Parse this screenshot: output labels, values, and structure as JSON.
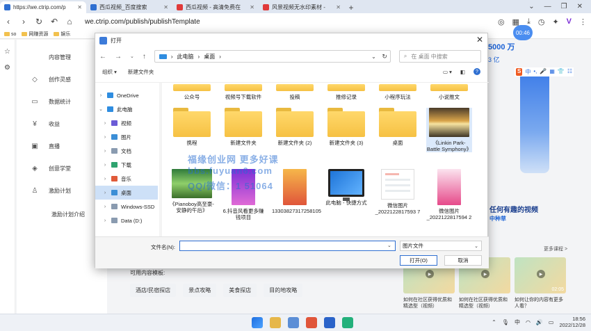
{
  "browser": {
    "tabs": [
      {
        "title": "https://we.ctrip.com/p",
        "color": "#2f6fd1",
        "active": true
      },
      {
        "title": "西瓜视频_百度搜索",
        "color": "#2f6fd1",
        "active": false
      },
      {
        "title": "西瓜视频 - 高清免费在",
        "color": "#e03a3a",
        "active": false
      },
      {
        "title": "风景视频无水印素材 -",
        "color": "#e03a3a",
        "active": false
      }
    ],
    "new_tab": "+",
    "url": "we.ctrip.com/publish/publishTemplate",
    "timer": "00:46",
    "bookmarks": [
      "so",
      "网赚资源",
      "娱乐"
    ]
  },
  "page": {
    "menu": [
      {
        "label": "内容管理",
        "icon": ""
      },
      {
        "label": "创作灵感",
        "icon": "◇"
      },
      {
        "label": "数据统计",
        "icon": "▭"
      },
      {
        "label": "收益",
        "icon": "¥"
      },
      {
        "label": "直播",
        "icon": "▣"
      },
      {
        "label": "创意学堂",
        "icon": "◈"
      },
      {
        "label": "激励计划",
        "icon": "♙"
      }
    ],
    "menu_sub": "激励计划介绍",
    "template_title": "可用内容模板:",
    "chips": [
      "酒店/民宿探店",
      "景点攻略",
      "美食探店",
      "目的地攻略"
    ],
    "stat1": "5000 万",
    "stat2": "3 亿",
    "ime": [
      "S",
      "中",
      "•,",
      "🎤",
      "▦",
      "👕",
      "☷"
    ],
    "slogan": "任何有趣的视频",
    "slogan2": "中种草",
    "more": "更多课程 >",
    "videos": [
      {
        "dur": "",
        "caption": "如何在社区获得优质和精选型（视频）"
      },
      {
        "dur": "",
        "caption": "如何在社区获得优质和精选型（视频）"
      },
      {
        "dur": "02:05",
        "caption": "如何让你的内容有更多人看？"
      }
    ]
  },
  "dialog": {
    "title": "打开",
    "path": [
      "此电脑",
      "桌面"
    ],
    "search_placeholder": "在 桌面 中搜索",
    "organize": "组织 ▾",
    "new_folder": "新建文件夹",
    "tree": [
      {
        "label": "OneDrive",
        "chev": "›",
        "color": "#2f8de0",
        "sel": false
      },
      {
        "label": "此电脑",
        "chev": "⌄",
        "color": "#2f8de0",
        "sel": false
      },
      {
        "label": "视频",
        "chev": "›",
        "color": "#6b5bd6",
        "sel": false
      },
      {
        "label": "图片",
        "chev": "›",
        "color": "#3b8ed6",
        "sel": false
      },
      {
        "label": "文档",
        "chev": "›",
        "color": "#8a9bb0",
        "sel": false
      },
      {
        "label": "下载",
        "chev": "›",
        "color": "#2fa36f",
        "sel": false
      },
      {
        "label": "音乐",
        "chev": "›",
        "color": "#e05a3a",
        "sel": false
      },
      {
        "label": "桌面",
        "chev": "›",
        "color": "#3b8ed6",
        "sel": true
      },
      {
        "label": "Windows-SSD",
        "chev": "›",
        "color": "#8a9bb0",
        "sel": false
      },
      {
        "label": "Data (D:)",
        "chev": "›",
        "color": "#8a9bb0",
        "sel": false
      }
    ],
    "row1": [
      "公众号",
      "视频号下载软件",
      "投稿",
      "推修记录",
      "小程序玩法",
      "小说推文"
    ],
    "row2": [
      "携程",
      "新建文件夹",
      "新建文件夹 (2)",
      "新建文件夹 (3)",
      "桌面",
      "《Linkin Park-Battle Symphony》"
    ],
    "row3": [
      "《Pianoboy高至豪-安静的午后》",
      "6.抖音风看更多赚钱项目",
      "13303827317258105",
      "此电脑 - 快捷方式",
      "微信图片_2022122817593 7",
      "微信图片_2022122817594 2"
    ],
    "filename_label": "文件名(N):",
    "filename_value": "",
    "filetype": "图片文件",
    "open_btn": "打开(O)",
    "cancel_btn": "取消"
  },
  "watermark": {
    "line1": "福缘创业网 更多好课",
    "line2": "bbs.fuyuan6.com",
    "line3": "QQ/微信：1 51064"
  },
  "taskbar": {
    "ime": "中",
    "time": "18:56",
    "date": "2022/12/28"
  }
}
